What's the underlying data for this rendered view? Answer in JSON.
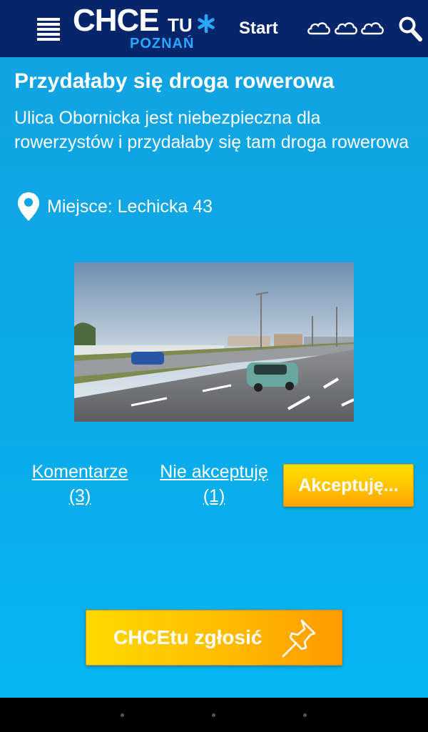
{
  "header": {
    "logo_main": "CHCE",
    "logo_tu": "TU",
    "logo_city": "POZNAŃ",
    "nav_start": "Start",
    "weather_icons": [
      "cloud-icon",
      "cloud-icon",
      "cloud-icon"
    ],
    "search_icon": "search-icon",
    "menu_icon": "menu-icon"
  },
  "post": {
    "title": "Przydałaby się droga rowerowa",
    "description": "Ulica Obornicka jest niebezpieczna dla rowerzystów i przydałaby się tam droga rowerowa",
    "location_label": "Miejsce: Lechicka 43",
    "location_icon": "map-pin-icon"
  },
  "actions": {
    "comments_label": "Komentarze",
    "comments_count": "(3)",
    "reject_label": "Nie akceptuję",
    "reject_count": "(1)",
    "accept_label": "Akceptuję..."
  },
  "report": {
    "label": "CHCEtu zgłosić",
    "icon": "pushpin-icon"
  },
  "colors": {
    "header_bg": "#07256b",
    "page_bg": "#0aaae8",
    "button_yellow": "#ffc200",
    "button_orange": "#ff9a00",
    "logo_city": "#29a8ff"
  }
}
